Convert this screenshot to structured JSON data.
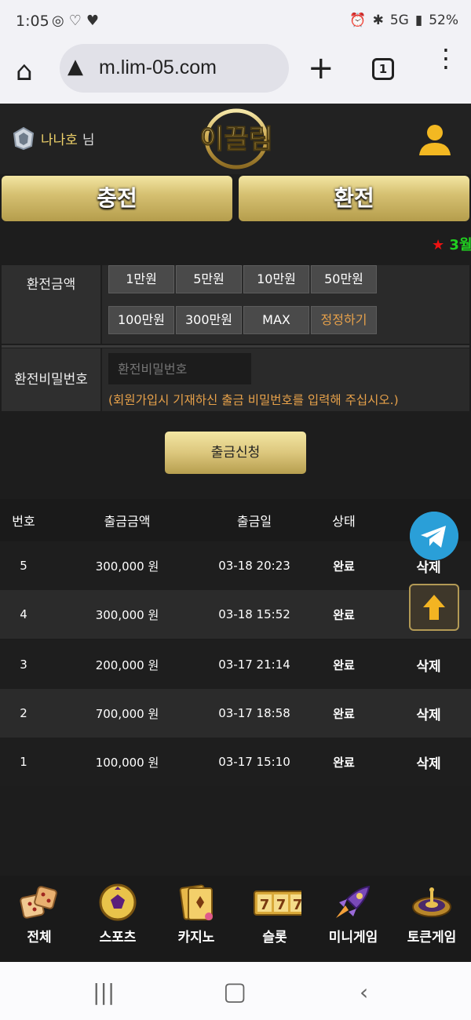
{
  "status": {
    "time": "1:05",
    "battery": "52%",
    "network": "5G"
  },
  "browser": {
    "url": "m.lim-05.com",
    "tab_count": "1"
  },
  "header": {
    "username": "나나호",
    "user_suffix": "님",
    "logo_text": "이끌림"
  },
  "actions": {
    "charge": "충전",
    "exchange": "환전"
  },
  "marquee": {
    "star": "★",
    "text": "3월"
  },
  "form": {
    "amount_label": "환전금액",
    "amount_buttons": [
      "1만원",
      "5만원",
      "10만원",
      "50만원",
      "100만원",
      "300만원",
      "MAX",
      "정정하기"
    ],
    "password_label": "환전비밀번호",
    "password_placeholder": "환전비밀번호",
    "password_note": "(회원가입시 기재하신 출금 비밀번호를 입력해 주십시오.)",
    "submit": "출금신청"
  },
  "table": {
    "headers": [
      "번호",
      "출금금액",
      "출금일",
      "상태"
    ],
    "rows": [
      {
        "no": "5",
        "amount": "300,000 원",
        "date": "03-18 20:23",
        "status": "완료",
        "action": "삭제"
      },
      {
        "no": "4",
        "amount": "300,000 원",
        "date": "03-18 15:52",
        "status": "완료",
        "action": ""
      },
      {
        "no": "3",
        "amount": "200,000 원",
        "date": "03-17 21:14",
        "status": "완료",
        "action": "삭제"
      },
      {
        "no": "2",
        "amount": "700,000 원",
        "date": "03-17 18:58",
        "status": "완료",
        "action": "삭제"
      },
      {
        "no": "1",
        "amount": "100,000 원",
        "date": "03-17 15:10",
        "status": "완료",
        "action": "삭제"
      }
    ]
  },
  "bottom_nav": [
    {
      "label": "전체",
      "icon": "dice-icon"
    },
    {
      "label": "스포츠",
      "icon": "soccer-ball-icon"
    },
    {
      "label": "카지노",
      "icon": "cards-icon"
    },
    {
      "label": "슬롯",
      "icon": "slot-777-icon"
    },
    {
      "label": "미니게임",
      "icon": "rocket-icon"
    },
    {
      "label": "토큰게임",
      "icon": "roulette-icon"
    }
  ],
  "colors": {
    "gold": "#d6c172",
    "accent_orange": "#e7a14a",
    "telegram": "#2a9fd8"
  }
}
